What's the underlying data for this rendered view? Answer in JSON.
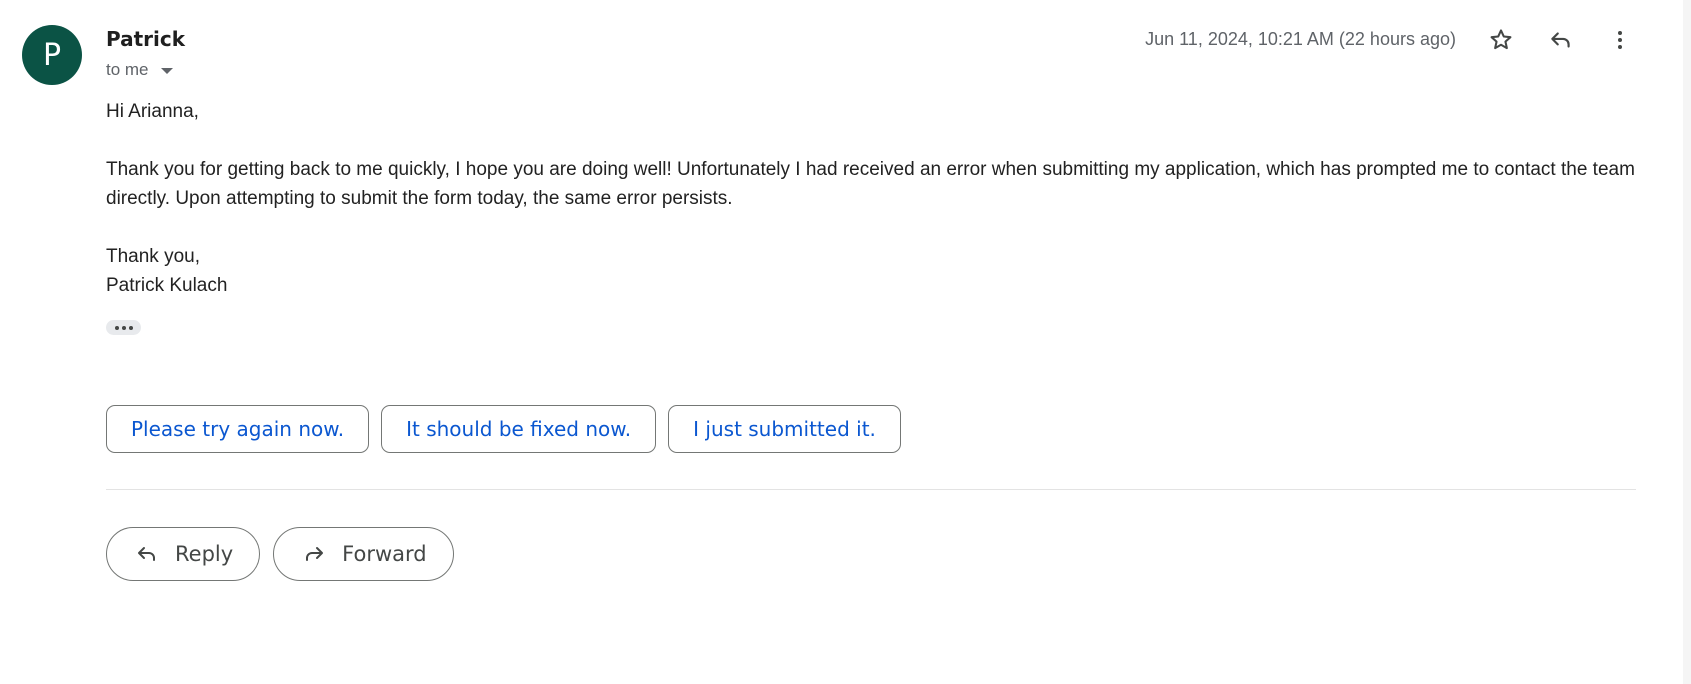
{
  "message": {
    "sender_initial": "P",
    "sender_name": "Patrick",
    "to_label": "to me",
    "timestamp": "Jun 11, 2024, 10:21 AM (22 hours ago)",
    "avatar_color": "#0b5345",
    "body": {
      "greeting": "Hi Arianna,",
      "paragraph": "Thank you for getting back to me quickly, I hope you are doing well! Unfortunately I had received an error when submitting my application, which has prompted me to contact the team directly. Upon attempting to submit the form today, the same error persists.",
      "closing": "Thank you,",
      "signature": "Patrick Kulach"
    }
  },
  "header_actions": {
    "icons": [
      "star-icon",
      "reply-icon",
      "more-vert-icon"
    ]
  },
  "smart_replies": [
    "Please try again now.",
    "It should be fixed now.",
    "I just submitted it."
  ],
  "actions": {
    "reply_label": "Reply",
    "forward_label": "Forward"
  },
  "colors": {
    "link_blue": "#0b57d0",
    "muted_text": "#5f6368"
  }
}
